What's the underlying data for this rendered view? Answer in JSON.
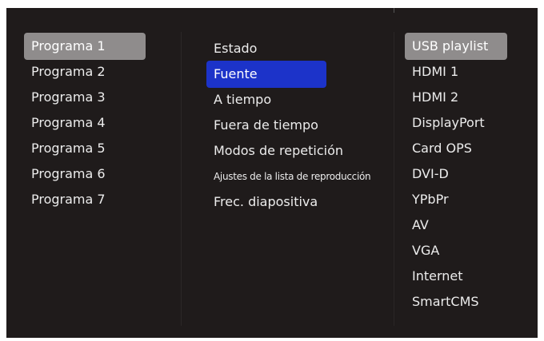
{
  "colors": {
    "background": "#1f1b1b",
    "text": "#ececec",
    "highlight_grey": "#8f8c8c",
    "highlight_blue": "#1c33c9"
  },
  "programs": {
    "items": [
      {
        "label": "Programa 1",
        "selected": true
      },
      {
        "label": "Programa 2",
        "selected": false
      },
      {
        "label": "Programa 3",
        "selected": false
      },
      {
        "label": "Programa 4",
        "selected": false
      },
      {
        "label": "Programa 5",
        "selected": false
      },
      {
        "label": "Programa 6",
        "selected": false
      },
      {
        "label": "Programa 7",
        "selected": false
      }
    ]
  },
  "settings": {
    "items": [
      {
        "label": "Estado",
        "selected": false
      },
      {
        "label": "Fuente",
        "selected": true
      },
      {
        "label": "A tiempo",
        "selected": false
      },
      {
        "label": "Fuera de tiempo",
        "selected": false
      },
      {
        "label": "Modos de repetición",
        "selected": false
      },
      {
        "label": "Ajustes de la lista de reproducción",
        "selected": false
      },
      {
        "label": "Frec. diapositiva",
        "selected": false
      }
    ]
  },
  "sources": {
    "items": [
      {
        "label": "USB playlist",
        "selected": true
      },
      {
        "label": "HDMI 1",
        "selected": false
      },
      {
        "label": "HDMI 2",
        "selected": false
      },
      {
        "label": "DisplayPort",
        "selected": false
      },
      {
        "label": "Card OPS",
        "selected": false
      },
      {
        "label": "DVI-D",
        "selected": false
      },
      {
        "label": "YPbPr",
        "selected": false
      },
      {
        "label": "AV",
        "selected": false
      },
      {
        "label": "VGA",
        "selected": false
      },
      {
        "label": "Internet",
        "selected": false
      },
      {
        "label": "SmartCMS",
        "selected": false
      }
    ]
  }
}
